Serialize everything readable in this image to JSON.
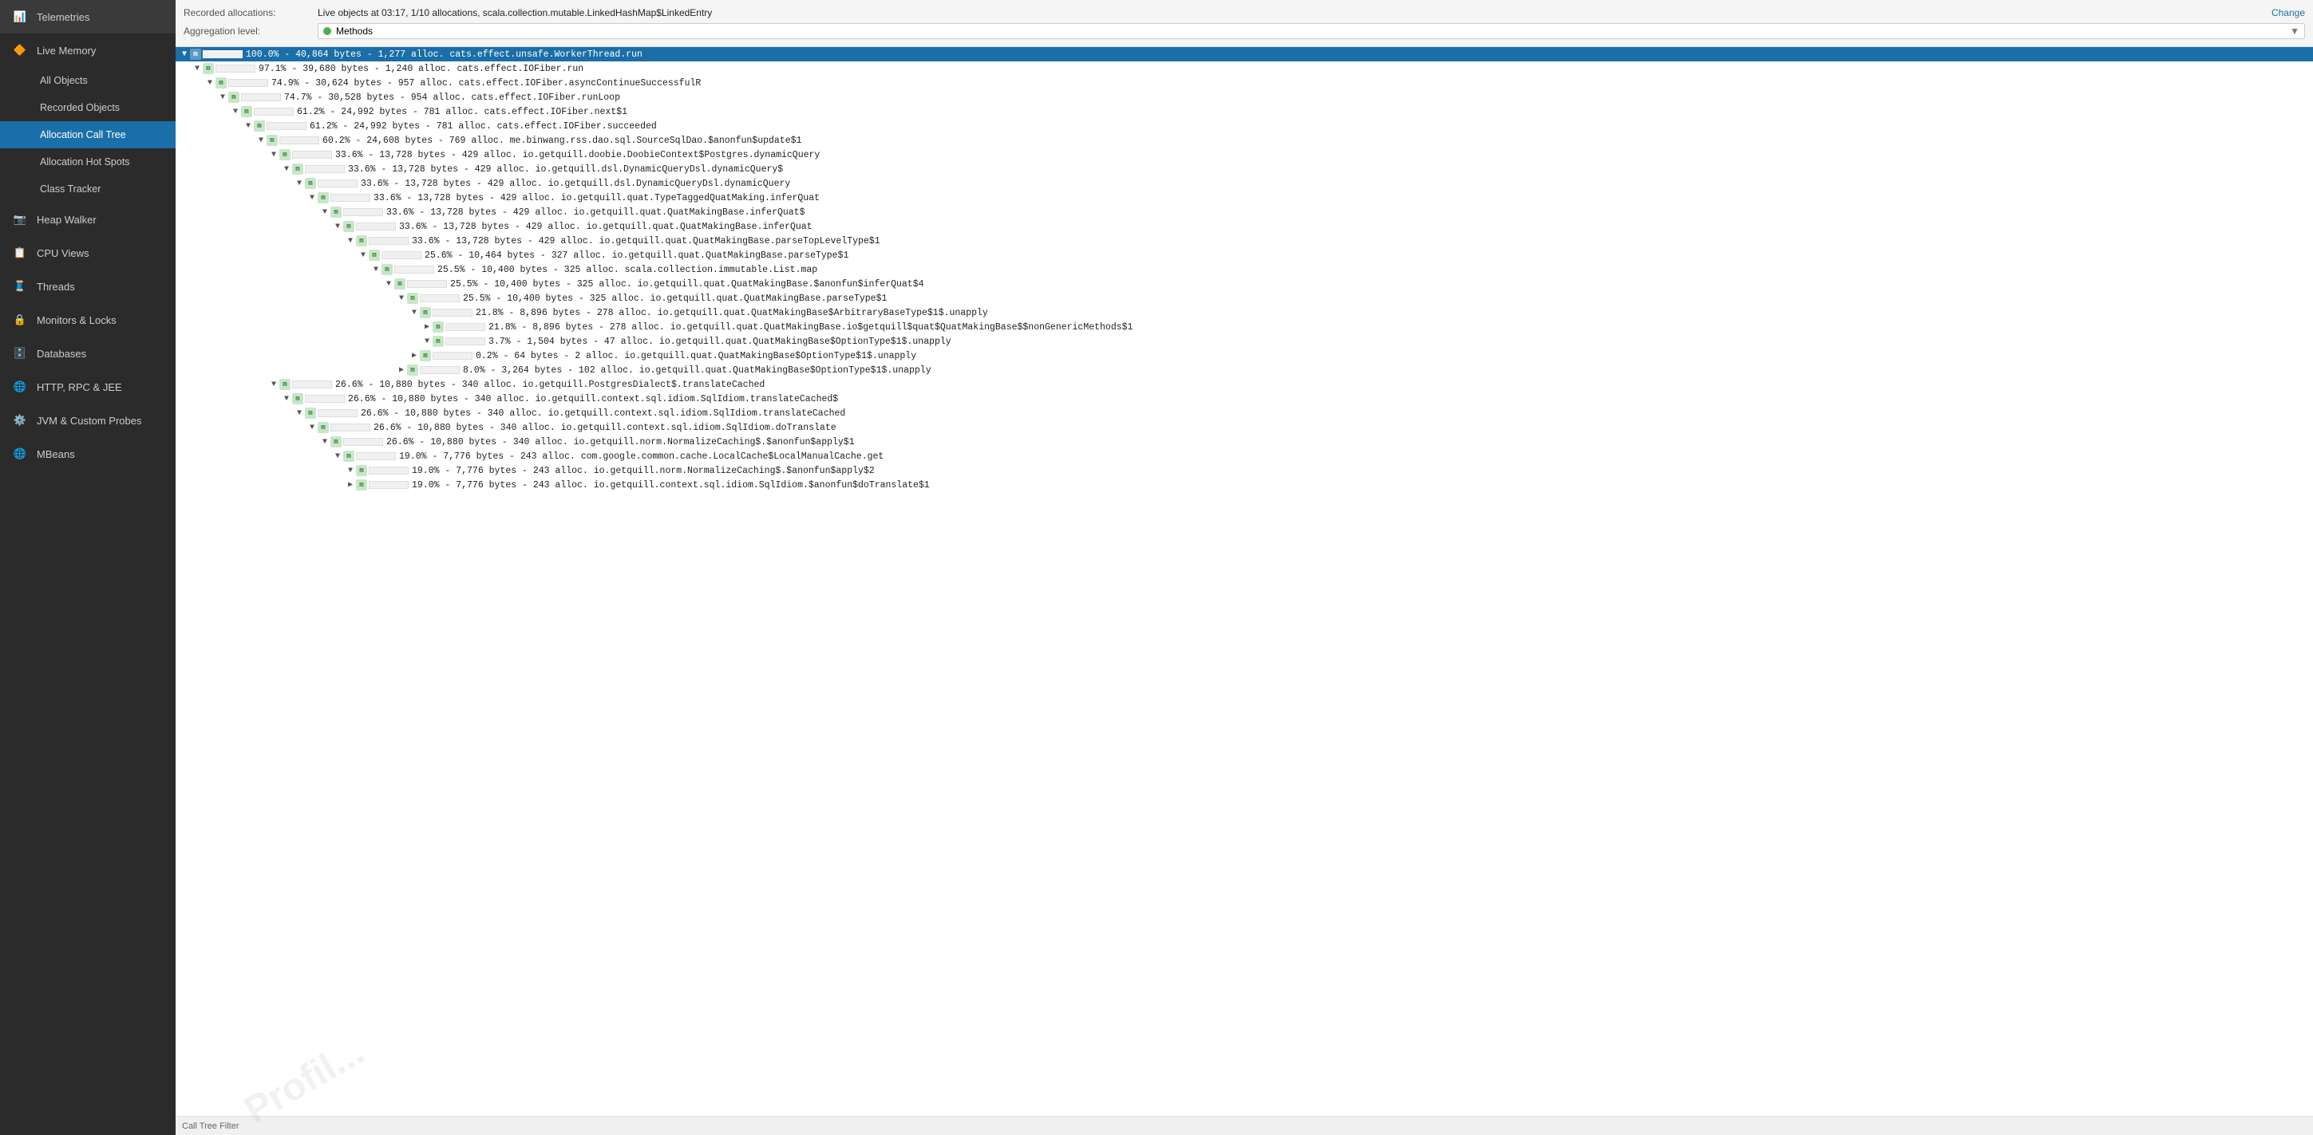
{
  "sidebar": {
    "items": [
      {
        "id": "telemetries",
        "label": "Telemetries",
        "icon": "📊",
        "indent": 0
      },
      {
        "id": "live-memory",
        "label": "Live Memory",
        "icon": "🔶",
        "indent": 0
      },
      {
        "id": "all-objects",
        "label": "All Objects",
        "icon": "",
        "indent": 1
      },
      {
        "id": "recorded-objects",
        "label": "Recorded Objects",
        "icon": "",
        "indent": 1
      },
      {
        "id": "allocation-call-tree",
        "label": "Allocation Call Tree",
        "icon": "",
        "indent": 1,
        "active": true
      },
      {
        "id": "allocation-hot-spots",
        "label": "Allocation Hot Spots",
        "icon": "",
        "indent": 1
      },
      {
        "id": "class-tracker",
        "label": "Class Tracker",
        "icon": "",
        "indent": 1
      },
      {
        "id": "heap-walker",
        "label": "Heap Walker",
        "icon": "📷",
        "indent": 0
      },
      {
        "id": "cpu-views",
        "label": "CPU Views",
        "icon": "📋",
        "indent": 0
      },
      {
        "id": "threads",
        "label": "Threads",
        "icon": "🧵",
        "indent": 0
      },
      {
        "id": "monitors-locks",
        "label": "Monitors & Locks",
        "icon": "🔒",
        "indent": 0
      },
      {
        "id": "databases",
        "label": "Databases",
        "icon": "🗄️",
        "indent": 0
      },
      {
        "id": "http-rpc-jee",
        "label": "HTTP, RPC & JEE",
        "icon": "🌐",
        "indent": 0
      },
      {
        "id": "jvm-custom-probes",
        "label": "JVM & Custom Probes",
        "icon": "⚙️",
        "indent": 0
      },
      {
        "id": "mbeans",
        "label": "MBeans",
        "icon": "🌐",
        "indent": 0
      }
    ]
  },
  "topbar": {
    "recorded_allocations_label": "Recorded allocations:",
    "recorded_allocations_value": "Live objects at 03:17, 1/10 allocations, scala.collection.mutable.LinkedHashMap$LinkedEntry",
    "change_label": "Change",
    "aggregation_label": "Aggregation level:",
    "aggregation_value": "Methods"
  },
  "tree": {
    "rows": [
      {
        "indent": 0,
        "expanded": true,
        "selected": true,
        "pct": 100.0,
        "bar": 100,
        "text": "100.0% - 40,864 bytes - 1,277 alloc. cats.effect.unsafe.WorkerThread.run"
      },
      {
        "indent": 1,
        "expanded": true,
        "selected": false,
        "pct": 97.1,
        "bar": 97,
        "text": "97.1% - 39,680 bytes - 1,240 alloc. cats.effect.IOFiber.run"
      },
      {
        "indent": 2,
        "expanded": true,
        "selected": false,
        "pct": 74.9,
        "bar": 75,
        "text": "74.9% - 30,624 bytes - 957 alloc. cats.effect.IOFiber.asyncContinueSuccessfulR"
      },
      {
        "indent": 3,
        "expanded": true,
        "selected": false,
        "pct": 74.7,
        "bar": 75,
        "text": "74.7% - 30,528 bytes - 954 alloc. cats.effect.IOFiber.runLoop"
      },
      {
        "indent": 4,
        "expanded": true,
        "selected": false,
        "pct": 61.2,
        "bar": 61,
        "text": "61.2% - 24,992 bytes - 781 alloc. cats.effect.IOFiber.next$1"
      },
      {
        "indent": 5,
        "expanded": true,
        "selected": false,
        "pct": 61.2,
        "bar": 61,
        "text": "61.2% - 24,992 bytes - 781 alloc. cats.effect.IOFiber.succeeded"
      },
      {
        "indent": 6,
        "expanded": true,
        "selected": false,
        "pct": 60.2,
        "bar": 60,
        "text": "60.2% - 24,608 bytes - 769 alloc. me.binwang.rss.dao.sql.SourceSqlDao.$anonfun$update$1"
      },
      {
        "indent": 7,
        "expanded": true,
        "selected": false,
        "pct": 33.6,
        "bar": 34,
        "text": "33.6% - 13,728 bytes - 429 alloc. io.getquill.doobie.DoobieContext$Postgres.dynamicQuery"
      },
      {
        "indent": 8,
        "expanded": true,
        "selected": false,
        "pct": 33.6,
        "bar": 34,
        "text": "33.6% - 13,728 bytes - 429 alloc. io.getquill.dsl.DynamicQueryDsl.dynamicQuery$"
      },
      {
        "indent": 9,
        "expanded": true,
        "selected": false,
        "pct": 33.6,
        "bar": 34,
        "text": "33.6% - 13,728 bytes - 429 alloc. io.getquill.dsl.DynamicQueryDsl.dynamicQuery"
      },
      {
        "indent": 10,
        "expanded": true,
        "selected": false,
        "pct": 33.6,
        "bar": 34,
        "text": "33.6% - 13,728 bytes - 429 alloc. io.getquill.quat.TypeTaggedQuatMaking.inferQuat"
      },
      {
        "indent": 11,
        "expanded": true,
        "selected": false,
        "pct": 33.6,
        "bar": 34,
        "text": "33.6% - 13,728 bytes - 429 alloc. io.getquill.quat.QuatMakingBase.inferQuat$"
      },
      {
        "indent": 12,
        "expanded": true,
        "selected": false,
        "pct": 33.6,
        "bar": 34,
        "text": "33.6% - 13,728 bytes - 429 alloc. io.getquill.quat.QuatMakingBase.inferQuat"
      },
      {
        "indent": 13,
        "expanded": true,
        "selected": false,
        "pct": 33.6,
        "bar": 34,
        "text": "33.6% - 13,728 bytes - 429 alloc. io.getquill.quat.QuatMakingBase.parseTopLevelType$1"
      },
      {
        "indent": 14,
        "expanded": true,
        "selected": false,
        "pct": 25.6,
        "bar": 26,
        "text": "25.6% - 10,464 bytes - 327 alloc. io.getquill.quat.QuatMakingBase.parseType$1"
      },
      {
        "indent": 15,
        "expanded": true,
        "selected": false,
        "pct": 25.5,
        "bar": 26,
        "text": "25.5% - 10,400 bytes - 325 alloc. scala.collection.immutable.List.map"
      },
      {
        "indent": 16,
        "expanded": true,
        "selected": false,
        "pct": 25.5,
        "bar": 26,
        "text": "25.5% - 10,400 bytes - 325 alloc. io.getquill.quat.QuatMakingBase.$anonfun$inferQuat$4"
      },
      {
        "indent": 17,
        "expanded": true,
        "selected": false,
        "pct": 25.5,
        "bar": 26,
        "text": "25.5% - 10,400 bytes - 325 alloc. io.getquill.quat.QuatMakingBase.parseType$1"
      },
      {
        "indent": 18,
        "expanded": true,
        "selected": false,
        "pct": 21.8,
        "bar": 22,
        "text": "21.8% - 8,896 bytes - 278 alloc. io.getquill.quat.QuatMakingBase$ArbitraryBaseType$1$.unapply"
      },
      {
        "indent": 19,
        "expanded": false,
        "selected": false,
        "pct": 21.8,
        "bar": 22,
        "text": "21.8% - 8,896 bytes - 278 alloc. io.getquill.quat.QuatMakingBase.io$getquill$quat$QuatMakingBase$$nonGenericMethods$1"
      },
      {
        "indent": 19,
        "expanded": true,
        "selected": false,
        "pct": 3.7,
        "bar": 4,
        "text": "3.7% - 1,504 bytes - 47 alloc. io.getquill.quat.QuatMakingBase$OptionType$1$.unapply"
      },
      {
        "indent": 18,
        "expanded": false,
        "selected": false,
        "pct": 0.2,
        "bar": 0,
        "text": "0.2% - 64 bytes - 2 alloc. io.getquill.quat.QuatMakingBase$OptionType$1$.unapply"
      },
      {
        "indent": 17,
        "expanded": false,
        "selected": false,
        "pct": 8.0,
        "bar": 8,
        "text": "8.0% - 3,264 bytes - 102 alloc. io.getquill.quat.QuatMakingBase$OptionType$1$.unapply"
      },
      {
        "indent": 7,
        "expanded": true,
        "selected": false,
        "pct": 26.6,
        "bar": 27,
        "text": "26.6% - 10,880 bytes - 340 alloc. io.getquill.PostgresDialect$.translateCached"
      },
      {
        "indent": 8,
        "expanded": true,
        "selected": false,
        "pct": 26.6,
        "bar": 27,
        "text": "26.6% - 10,880 bytes - 340 alloc. io.getquill.context.sql.idiom.SqlIdiom.translateCached$"
      },
      {
        "indent": 9,
        "expanded": true,
        "selected": false,
        "pct": 26.6,
        "bar": 27,
        "text": "26.6% - 10,880 bytes - 340 alloc. io.getquill.context.sql.idiom.SqlIdiom.translateCached"
      },
      {
        "indent": 10,
        "expanded": true,
        "selected": false,
        "pct": 26.6,
        "bar": 27,
        "text": "26.6% - 10,880 bytes - 340 alloc. io.getquill.context.sql.idiom.SqlIdiom.doTranslate"
      },
      {
        "indent": 11,
        "expanded": true,
        "selected": false,
        "pct": 26.6,
        "bar": 27,
        "text": "26.6% - 10,880 bytes - 340 alloc. io.getquill.norm.NormalizeCaching$.$anonfun$apply$1"
      },
      {
        "indent": 12,
        "expanded": true,
        "selected": false,
        "pct": 19.0,
        "bar": 19,
        "text": "19.0% - 7,776 bytes - 243 alloc. com.google.common.cache.LocalCache$LocalManualCache.get"
      },
      {
        "indent": 13,
        "expanded": true,
        "selected": false,
        "pct": 19.0,
        "bar": 19,
        "text": "19.0% - 7,776 bytes - 243 alloc. io.getquill.norm.NormalizeCaching$.$anonfun$apply$2"
      },
      {
        "indent": 13,
        "expanded": false,
        "selected": false,
        "pct": 19.0,
        "bar": 19,
        "text": "19.0% - 7,776 bytes - 243 alloc. io.getquill.context.sql.idiom.SqlIdiom.$anonfun$doTranslate$1"
      }
    ]
  },
  "bottom_bar": {
    "text": "Call Tree  Filter"
  },
  "watermark": "Profil..."
}
